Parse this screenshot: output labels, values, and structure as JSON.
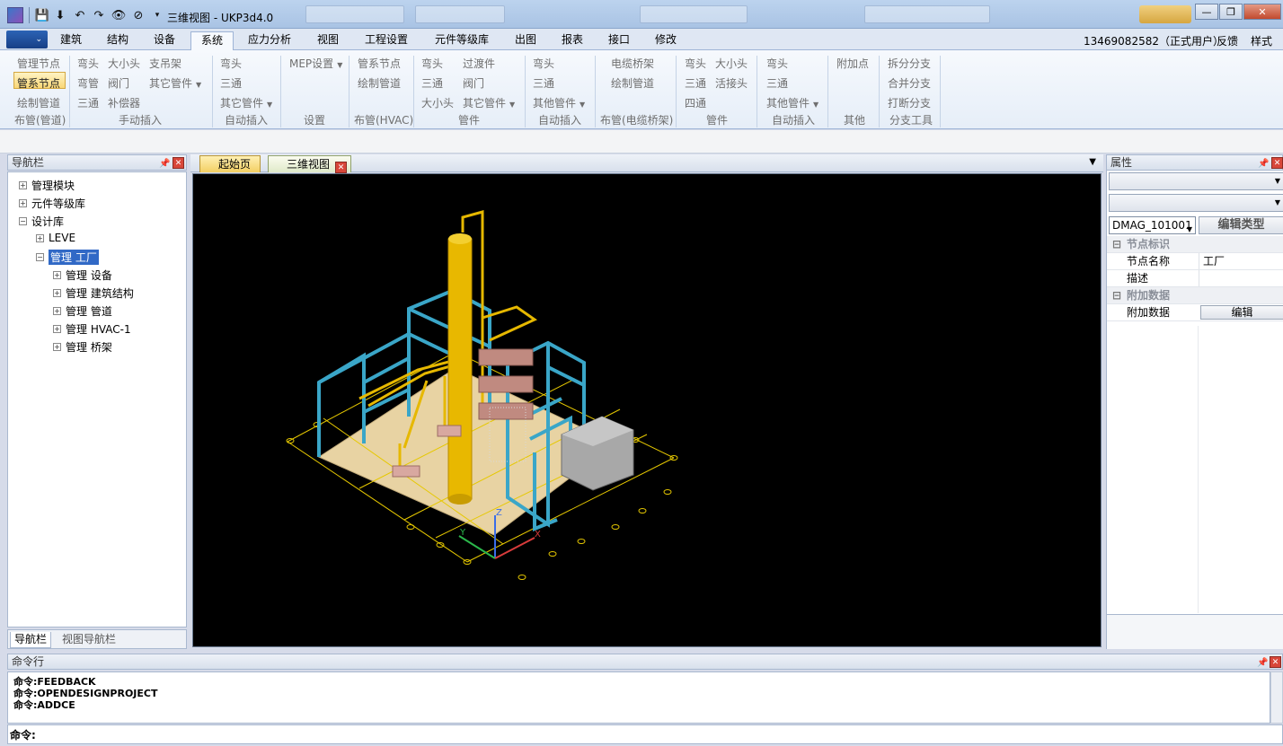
{
  "window": {
    "title": "三维视图 - UKP3d4.0",
    "controls": [
      "—",
      "❐",
      "✕"
    ]
  },
  "menu": {
    "tabs": [
      "建筑",
      "结构",
      "设备",
      "系统",
      "应力分析",
      "视图",
      "工程设置",
      "元件等级库",
      "出图",
      "报表",
      "接口",
      "修改"
    ],
    "active_tab": "系统",
    "user": "13469082582（正式用户）",
    "feedback": "反馈",
    "style": "样式"
  },
  "ribbon": {
    "g1": {
      "items": [
        "管理节点",
        "管系节点",
        "绘制管道"
      ],
      "label": "布管(管道)"
    },
    "g2": {
      "items": [
        "弯头",
        "大小头",
        "支吊架",
        "弯管",
        "阀门",
        "其它管件",
        "三通",
        "补偿器"
      ],
      "label": "手动插入"
    },
    "g3": {
      "items": [
        "弯头",
        "三通",
        "其它管件"
      ],
      "label": "自动插入"
    },
    "g4": {
      "items": [
        "MEP设置"
      ],
      "label": "设置"
    },
    "g5": {
      "items": [
        "管系节点",
        "绘制管道"
      ],
      "label": "布管(HVAC)"
    },
    "g6": {
      "items": [
        "弯头",
        "过渡件",
        "三通",
        "阀门",
        "大小头",
        "其它管件"
      ],
      "label": "管件"
    },
    "g7": {
      "items": [
        "弯头",
        "三通",
        "其他管件"
      ],
      "label": "自动插入"
    },
    "g8": {
      "items": [
        "电缆桥架",
        "绘制管道"
      ],
      "label": "布管(电缆桥架)"
    },
    "g9": {
      "items": [
        "弯头",
        "大小头",
        "三通",
        "活接头",
        "四通"
      ],
      "label": "管件"
    },
    "g10": {
      "items": [
        "弯头",
        "三通",
        "其他管件"
      ],
      "label": "自动插入"
    },
    "g11": {
      "items": [
        "附加点"
      ],
      "label": "其他"
    },
    "g12": {
      "items": [
        "拆分分支",
        "合并分支",
        "打断分支"
      ],
      "label": "分支工具"
    }
  },
  "nav": {
    "title": "导航栏",
    "tree": [
      {
        "label": "管理模块",
        "toggle": "+"
      },
      {
        "label": "元件等级库",
        "toggle": "+"
      },
      {
        "label": "设计库",
        "toggle": "−"
      },
      {
        "label": "LEVE",
        "toggle": "+"
      },
      {
        "label": "管理 工厂",
        "toggle": "−"
      },
      {
        "label": "管理 设备",
        "toggle": "+"
      },
      {
        "label": "管理 建筑结构",
        "toggle": "+"
      },
      {
        "label": "管理 管道",
        "toggle": "+"
      },
      {
        "label": "管理 HVAC-1",
        "toggle": "+"
      },
      {
        "label": "管理 桥架",
        "toggle": "+"
      }
    ],
    "tabs": [
      "导航栏",
      "视图导航栏"
    ]
  },
  "docs": {
    "tabs": [
      "起始页",
      "三维视图"
    ]
  },
  "viewport": {
    "axis_labels": {
      "x": "X",
      "y": "Y",
      "z": "Z"
    }
  },
  "properties": {
    "title": "属性",
    "type_select": "DMAG_101001",
    "edit_type": "编辑类型",
    "categories": [
      {
        "name": "节点标识",
        "rows": [
          {
            "name": "节点名称",
            "value": "工厂"
          },
          {
            "name": "描述",
            "value": ""
          }
        ]
      },
      {
        "name": "附加数据",
        "rows": [
          {
            "name": "附加数据",
            "button": "编辑"
          }
        ]
      }
    ]
  },
  "command": {
    "title": "命令行",
    "history": [
      "命令:FEEDBACK",
      "命令:OPENDESIGNPROJECT",
      "命令:ADDCE"
    ],
    "prompt": "命令:",
    "input_value": ""
  },
  "colors": {
    "accent": "#3169c6",
    "viewport_bg": "#000000",
    "steel": "#3aa6c8",
    "pipe": "#e6b800",
    "floor": "#e8d3a3"
  }
}
